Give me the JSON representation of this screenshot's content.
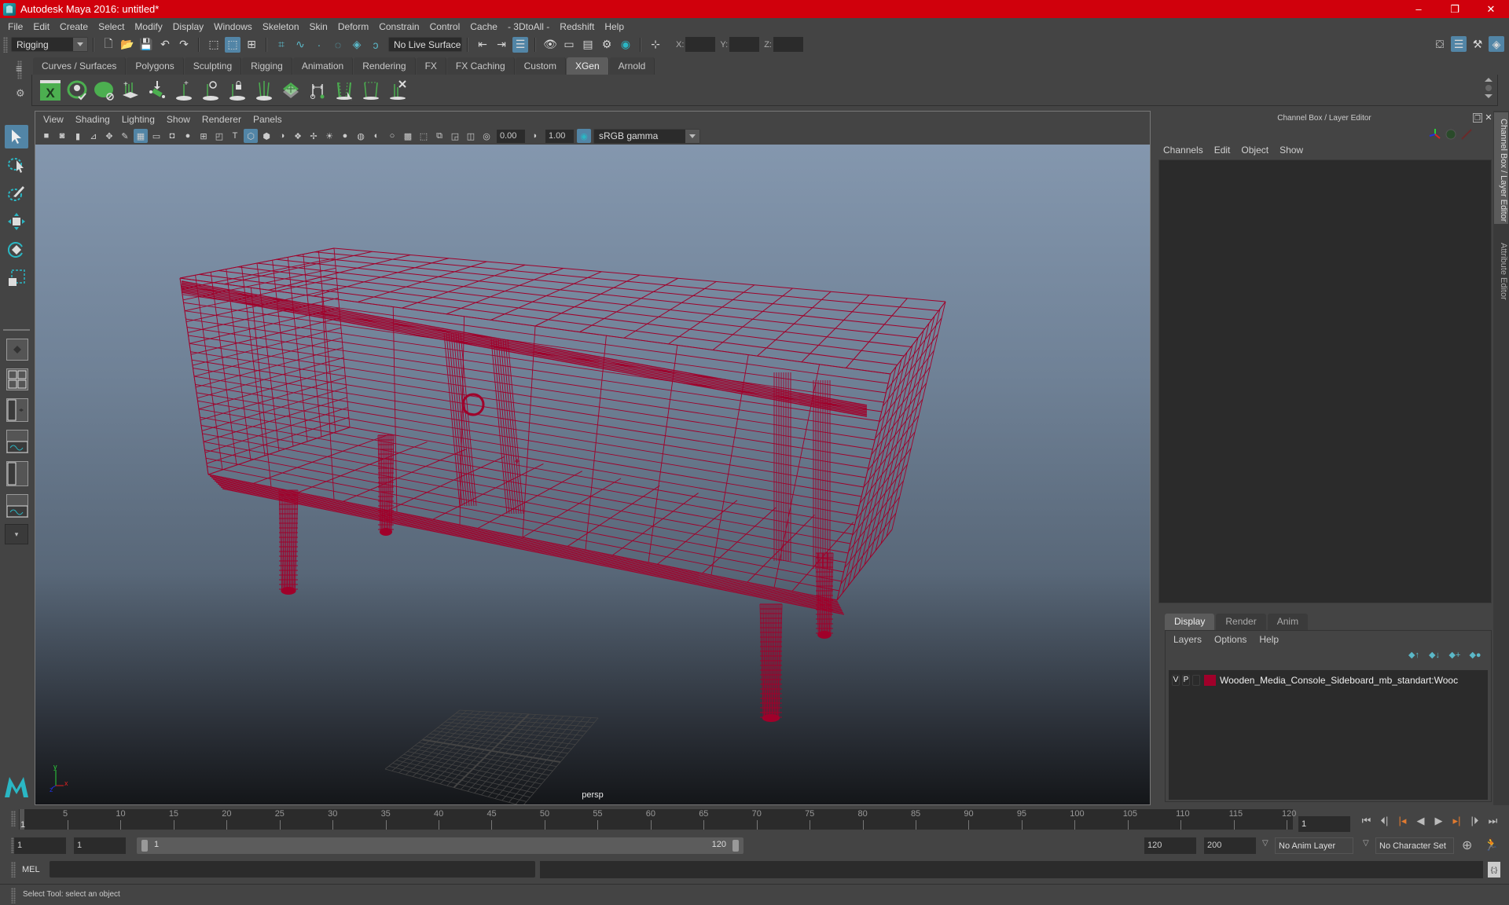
{
  "window": {
    "title": "Autodesk Maya 2016: untitled*",
    "controls": {
      "minimize": "–",
      "restore": "❐",
      "close": "✕"
    }
  },
  "menubar": {
    "items": [
      "File",
      "Edit",
      "Create",
      "Select",
      "Modify",
      "Display",
      "Windows",
      "Skeleton",
      "Skin",
      "Deform",
      "Constrain",
      "Control",
      "Cache",
      "- 3DtoAll -",
      "Redshift",
      "Help"
    ]
  },
  "statusline": {
    "menuset": "Rigging",
    "live_surface": "No Live Surface",
    "coord_labels": {
      "x": "X:",
      "y": "Y:",
      "z": "Z:"
    },
    "coords": {
      "x": "",
      "y": "",
      "z": ""
    }
  },
  "shelf": {
    "tabs": [
      "Curves / Surfaces",
      "Polygons",
      "Sculpting",
      "Rigging",
      "Animation",
      "Rendering",
      "FX",
      "FX Caching",
      "Custom",
      "XGen",
      "Arnold"
    ],
    "active_tab": "XGen",
    "icons": [
      "xgen-window-icon",
      "xgen-preview-icon",
      "xgen-clear-preview-icon",
      "add-guides-icon",
      "edit-guides-icon",
      "add-guide-icon",
      "sculpt-guide-icon",
      "lock-guide-icon",
      "guide-to-curves-icon",
      "density-map-icon",
      "move-guides-icon",
      "select-guides-icon",
      "guide-tool-icon",
      "delete-guides-icon"
    ]
  },
  "viewport": {
    "menu": [
      "View",
      "Shading",
      "Lighting",
      "Show",
      "Renderer",
      "Panels"
    ],
    "exposure": "0.00",
    "gamma": "1.00",
    "color_space": "sRGB gamma",
    "camera_label": "persp",
    "wireframe_color": "#a0002a",
    "axis_labels": {
      "x": "x",
      "y": "y",
      "z": "z"
    }
  },
  "channel_box": {
    "title": "Channel Box / Layer Editor",
    "menu": [
      "Channels",
      "Edit",
      "Object",
      "Show"
    ]
  },
  "layer_editor": {
    "tabs": [
      "Display",
      "Render",
      "Anim"
    ],
    "active_tab": "Display",
    "menu": [
      "Layers",
      "Options",
      "Help"
    ],
    "layers": [
      {
        "v": "V",
        "p": "P",
        "color": "#a0002a",
        "name": "Wooden_Media_Console_Sideboard_mb_standart:Wooc"
      }
    ]
  },
  "side_tabs": [
    "Channel Box / Layer Editor",
    "Attribute Editor"
  ],
  "timeline": {
    "start": 1,
    "end": 120,
    "current": "1",
    "tick_labels": [
      "5",
      "10",
      "15",
      "20",
      "25",
      "30",
      "35",
      "40",
      "45",
      "50",
      "55",
      "60",
      "65",
      "70",
      "75",
      "80",
      "85",
      "90",
      "95",
      "100",
      "105",
      "110",
      "115",
      "120"
    ],
    "current_frame_field": "1"
  },
  "range": {
    "start_field": "1",
    "playback_start": "1",
    "slider_start_label": "1",
    "slider_end_label": "120",
    "playback_end": "120",
    "end_field": "200",
    "anim_layer": "No Anim Layer",
    "character_set": "No Character Set"
  },
  "command_line": {
    "language": "MEL",
    "input": "",
    "output": ""
  },
  "help_line": {
    "text": "Select Tool: select an object"
  },
  "colors": {
    "title_bar": "#d0000c",
    "selection_blue": "#5285a6",
    "xgen_green": "#4caf50",
    "wireframe": "#a0002a"
  }
}
